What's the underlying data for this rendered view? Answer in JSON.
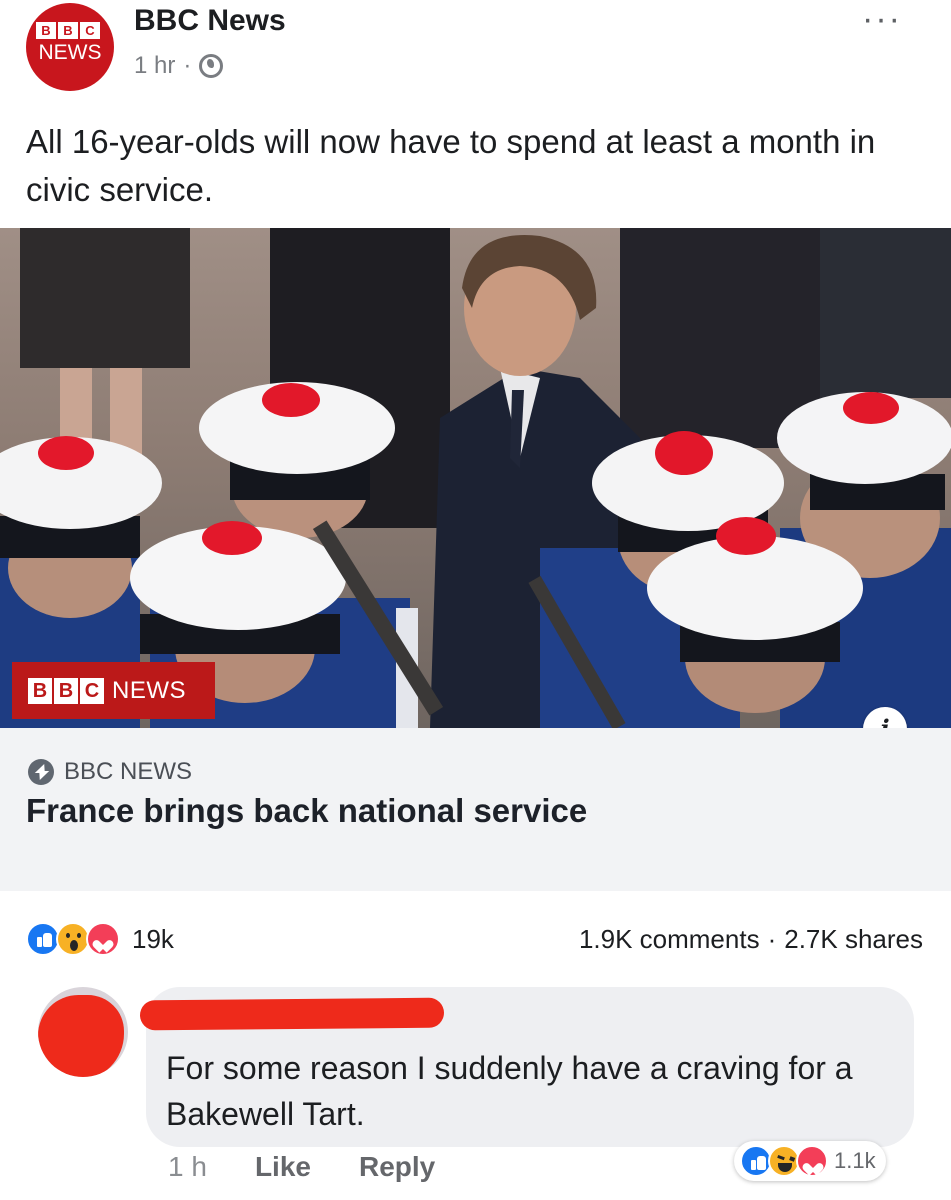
{
  "post": {
    "page_name": "BBC News",
    "avatar": {
      "blocks": [
        "B",
        "B",
        "C"
      ],
      "word": "NEWS"
    },
    "time": "1 hr",
    "separator": "·",
    "privacy_icon": "globe-icon",
    "more_label": "···",
    "text": "All 16-year-olds will now have to spend at least a month in civic service."
  },
  "image": {
    "watermark_blocks": [
      "B",
      "B",
      "C"
    ],
    "watermark_word": "NEWS",
    "info_label": "i"
  },
  "link": {
    "source": "BBC NEWS",
    "source_icon": "lightning-bolt-icon",
    "headline": "France brings back national service"
  },
  "stats": {
    "reaction_icons": [
      "like-icon",
      "wow-icon",
      "love-icon"
    ],
    "reaction_count": "19k",
    "comments": "1.9K comments",
    "separator": "·",
    "shares": "2.7K shares"
  },
  "comment": {
    "text": "For some reason I suddenly have a craving for a Bakewell Tart.",
    "time": "1 h",
    "like_label": "Like",
    "reply_label": "Reply",
    "reaction_icons": [
      "like-icon",
      "haha-icon",
      "love-icon"
    ],
    "reaction_count": "1.1k"
  },
  "colors": {
    "bbc_red": "#bb1919",
    "facebook_blue": "#1877f2",
    "love_red": "#f33e58",
    "emoji_yellow": "#f7b125",
    "redaction_red": "#ee2a1b"
  }
}
